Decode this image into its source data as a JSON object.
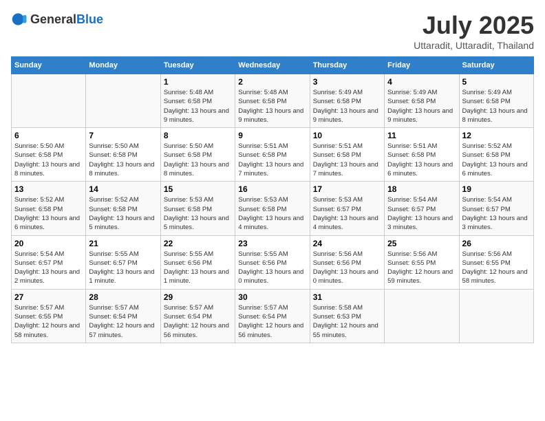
{
  "header": {
    "logo_general": "General",
    "logo_blue": "Blue",
    "title": "July 2025",
    "location": "Uttaradit, Uttaradit, Thailand"
  },
  "days_of_week": [
    "Sunday",
    "Monday",
    "Tuesday",
    "Wednesday",
    "Thursday",
    "Friday",
    "Saturday"
  ],
  "weeks": [
    [
      {
        "day": "",
        "info": ""
      },
      {
        "day": "",
        "info": ""
      },
      {
        "day": "1",
        "info": "Sunrise: 5:48 AM\nSunset: 6:58 PM\nDaylight: 13 hours and 9 minutes."
      },
      {
        "day": "2",
        "info": "Sunrise: 5:48 AM\nSunset: 6:58 PM\nDaylight: 13 hours and 9 minutes."
      },
      {
        "day": "3",
        "info": "Sunrise: 5:49 AM\nSunset: 6:58 PM\nDaylight: 13 hours and 9 minutes."
      },
      {
        "day": "4",
        "info": "Sunrise: 5:49 AM\nSunset: 6:58 PM\nDaylight: 13 hours and 9 minutes."
      },
      {
        "day": "5",
        "info": "Sunrise: 5:49 AM\nSunset: 6:58 PM\nDaylight: 13 hours and 8 minutes."
      }
    ],
    [
      {
        "day": "6",
        "info": "Sunrise: 5:50 AM\nSunset: 6:58 PM\nDaylight: 13 hours and 8 minutes."
      },
      {
        "day": "7",
        "info": "Sunrise: 5:50 AM\nSunset: 6:58 PM\nDaylight: 13 hours and 8 minutes."
      },
      {
        "day": "8",
        "info": "Sunrise: 5:50 AM\nSunset: 6:58 PM\nDaylight: 13 hours and 8 minutes."
      },
      {
        "day": "9",
        "info": "Sunrise: 5:51 AM\nSunset: 6:58 PM\nDaylight: 13 hours and 7 minutes."
      },
      {
        "day": "10",
        "info": "Sunrise: 5:51 AM\nSunset: 6:58 PM\nDaylight: 13 hours and 7 minutes."
      },
      {
        "day": "11",
        "info": "Sunrise: 5:51 AM\nSunset: 6:58 PM\nDaylight: 13 hours and 6 minutes."
      },
      {
        "day": "12",
        "info": "Sunrise: 5:52 AM\nSunset: 6:58 PM\nDaylight: 13 hours and 6 minutes."
      }
    ],
    [
      {
        "day": "13",
        "info": "Sunrise: 5:52 AM\nSunset: 6:58 PM\nDaylight: 13 hours and 6 minutes."
      },
      {
        "day": "14",
        "info": "Sunrise: 5:52 AM\nSunset: 6:58 PM\nDaylight: 13 hours and 5 minutes."
      },
      {
        "day": "15",
        "info": "Sunrise: 5:53 AM\nSunset: 6:58 PM\nDaylight: 13 hours and 5 minutes."
      },
      {
        "day": "16",
        "info": "Sunrise: 5:53 AM\nSunset: 6:58 PM\nDaylight: 13 hours and 4 minutes."
      },
      {
        "day": "17",
        "info": "Sunrise: 5:53 AM\nSunset: 6:57 PM\nDaylight: 13 hours and 4 minutes."
      },
      {
        "day": "18",
        "info": "Sunrise: 5:54 AM\nSunset: 6:57 PM\nDaylight: 13 hours and 3 minutes."
      },
      {
        "day": "19",
        "info": "Sunrise: 5:54 AM\nSunset: 6:57 PM\nDaylight: 13 hours and 3 minutes."
      }
    ],
    [
      {
        "day": "20",
        "info": "Sunrise: 5:54 AM\nSunset: 6:57 PM\nDaylight: 13 hours and 2 minutes."
      },
      {
        "day": "21",
        "info": "Sunrise: 5:55 AM\nSunset: 6:57 PM\nDaylight: 13 hours and 1 minute."
      },
      {
        "day": "22",
        "info": "Sunrise: 5:55 AM\nSunset: 6:56 PM\nDaylight: 13 hours and 1 minute."
      },
      {
        "day": "23",
        "info": "Sunrise: 5:55 AM\nSunset: 6:56 PM\nDaylight: 13 hours and 0 minutes."
      },
      {
        "day": "24",
        "info": "Sunrise: 5:56 AM\nSunset: 6:56 PM\nDaylight: 13 hours and 0 minutes."
      },
      {
        "day": "25",
        "info": "Sunrise: 5:56 AM\nSunset: 6:55 PM\nDaylight: 12 hours and 59 minutes."
      },
      {
        "day": "26",
        "info": "Sunrise: 5:56 AM\nSunset: 6:55 PM\nDaylight: 12 hours and 58 minutes."
      }
    ],
    [
      {
        "day": "27",
        "info": "Sunrise: 5:57 AM\nSunset: 6:55 PM\nDaylight: 12 hours and 58 minutes."
      },
      {
        "day": "28",
        "info": "Sunrise: 5:57 AM\nSunset: 6:54 PM\nDaylight: 12 hours and 57 minutes."
      },
      {
        "day": "29",
        "info": "Sunrise: 5:57 AM\nSunset: 6:54 PM\nDaylight: 12 hours and 56 minutes."
      },
      {
        "day": "30",
        "info": "Sunrise: 5:57 AM\nSunset: 6:54 PM\nDaylight: 12 hours and 56 minutes."
      },
      {
        "day": "31",
        "info": "Sunrise: 5:58 AM\nSunset: 6:53 PM\nDaylight: 12 hours and 55 minutes."
      },
      {
        "day": "",
        "info": ""
      },
      {
        "day": "",
        "info": ""
      }
    ]
  ]
}
